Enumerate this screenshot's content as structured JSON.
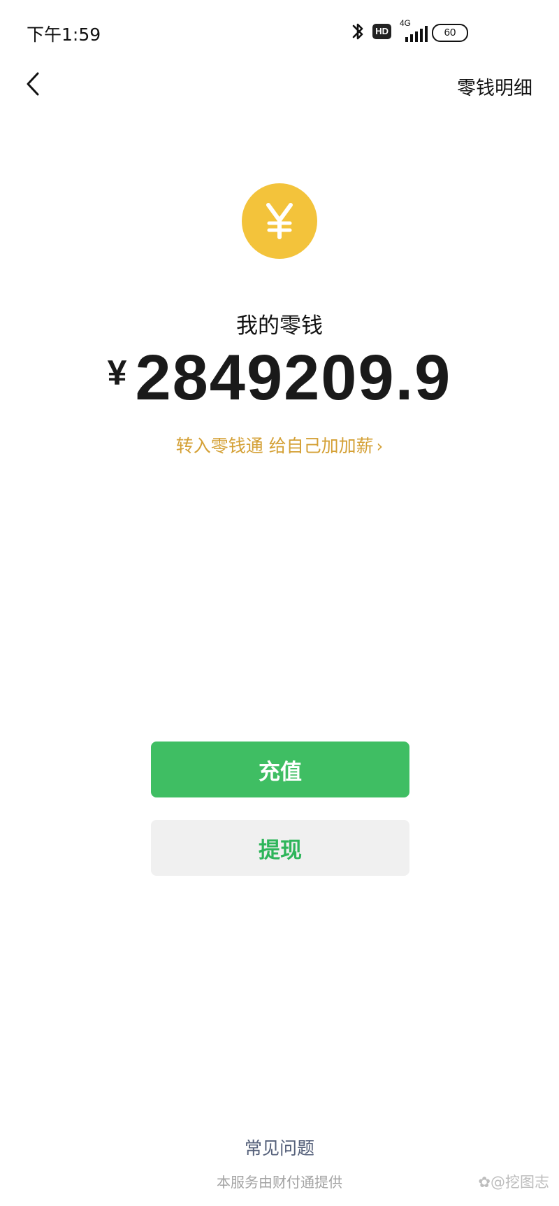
{
  "status_bar": {
    "time": "下午1:59",
    "hd_label": "HD",
    "network_label": "4G",
    "battery": "60",
    "signal_level": 5
  },
  "nav": {
    "back_icon": "chevron-left-icon",
    "details_label": "零钱明细"
  },
  "wallet": {
    "coin_icon": "yen-coin-icon",
    "coin_color": "#f3c33b",
    "title": "我的零钱",
    "currency_symbol": "¥",
    "balance": "2849209.9",
    "promo_text": "转入零钱通 给自己加加薪",
    "promo_chevron": "›",
    "promo_color": "#d4a035"
  },
  "actions": {
    "recharge_label": "充值",
    "recharge_color": "#3fbe63",
    "withdraw_label": "提现",
    "withdraw_color": "#2eb55a"
  },
  "footer": {
    "faq_label": "常见问题",
    "provider_text": "本服务由财付通提供",
    "watermark": "✿@挖图志"
  }
}
